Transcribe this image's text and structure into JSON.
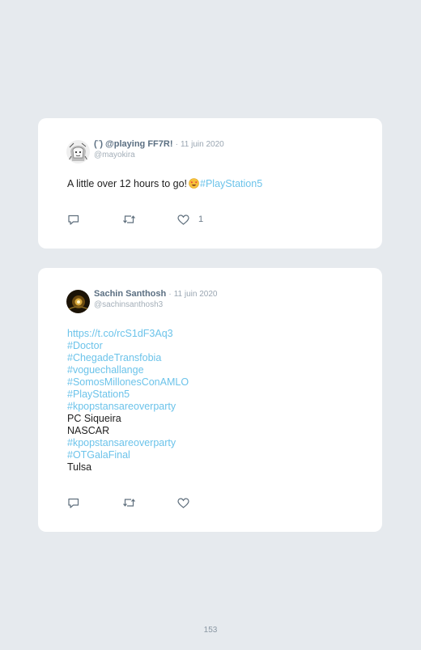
{
  "page_number": "153",
  "colors": {
    "background": "#e6eaee",
    "card": "#ffffff",
    "link": "#6cc3ea",
    "name": "#5b6f82",
    "muted": "#a3aeb8"
  },
  "tweets": [
    {
      "author_name": "(¨) @playing FF7R!",
      "date": "11 juin 2020",
      "handle": "@mayokira",
      "avatar_icon": "manga-sketch-avatar",
      "text_prefix": "A little over 12 hours to go!",
      "emoji_icon": "star-struck-emoji",
      "text_hashtag": "#PlayStation5",
      "like_count": "1"
    },
    {
      "author_name": "Sachin Santhosh",
      "date": "11 juin 2020",
      "handle": "@sachinsanthosh3",
      "avatar_icon": "night-light-photo-avatar",
      "lines": [
        {
          "text": "https://t.co/rcS1dF3Aq3",
          "link": true
        },
        {
          "text": "#Doctor",
          "link": true
        },
        {
          "text": "#ChegadeTransfobia",
          "link": true
        },
        {
          "text": "#voguechallange",
          "link": true
        },
        {
          "text": "#SomosMillonesConAMLO",
          "link": true
        },
        {
          "text": "#PlayStation5",
          "link": true
        },
        {
          "text": "#kpopstansareoverparty",
          "link": true
        },
        {
          "text": "PC Siqueira",
          "link": false
        },
        {
          "text": "NASCAR",
          "link": false
        },
        {
          "text": "#kpopstansareoverparty",
          "link": true
        },
        {
          "text": "#OTGalaFinal",
          "link": true
        },
        {
          "text": "Tulsa",
          "link": false
        }
      ],
      "like_count": ""
    }
  ],
  "separator": "·"
}
